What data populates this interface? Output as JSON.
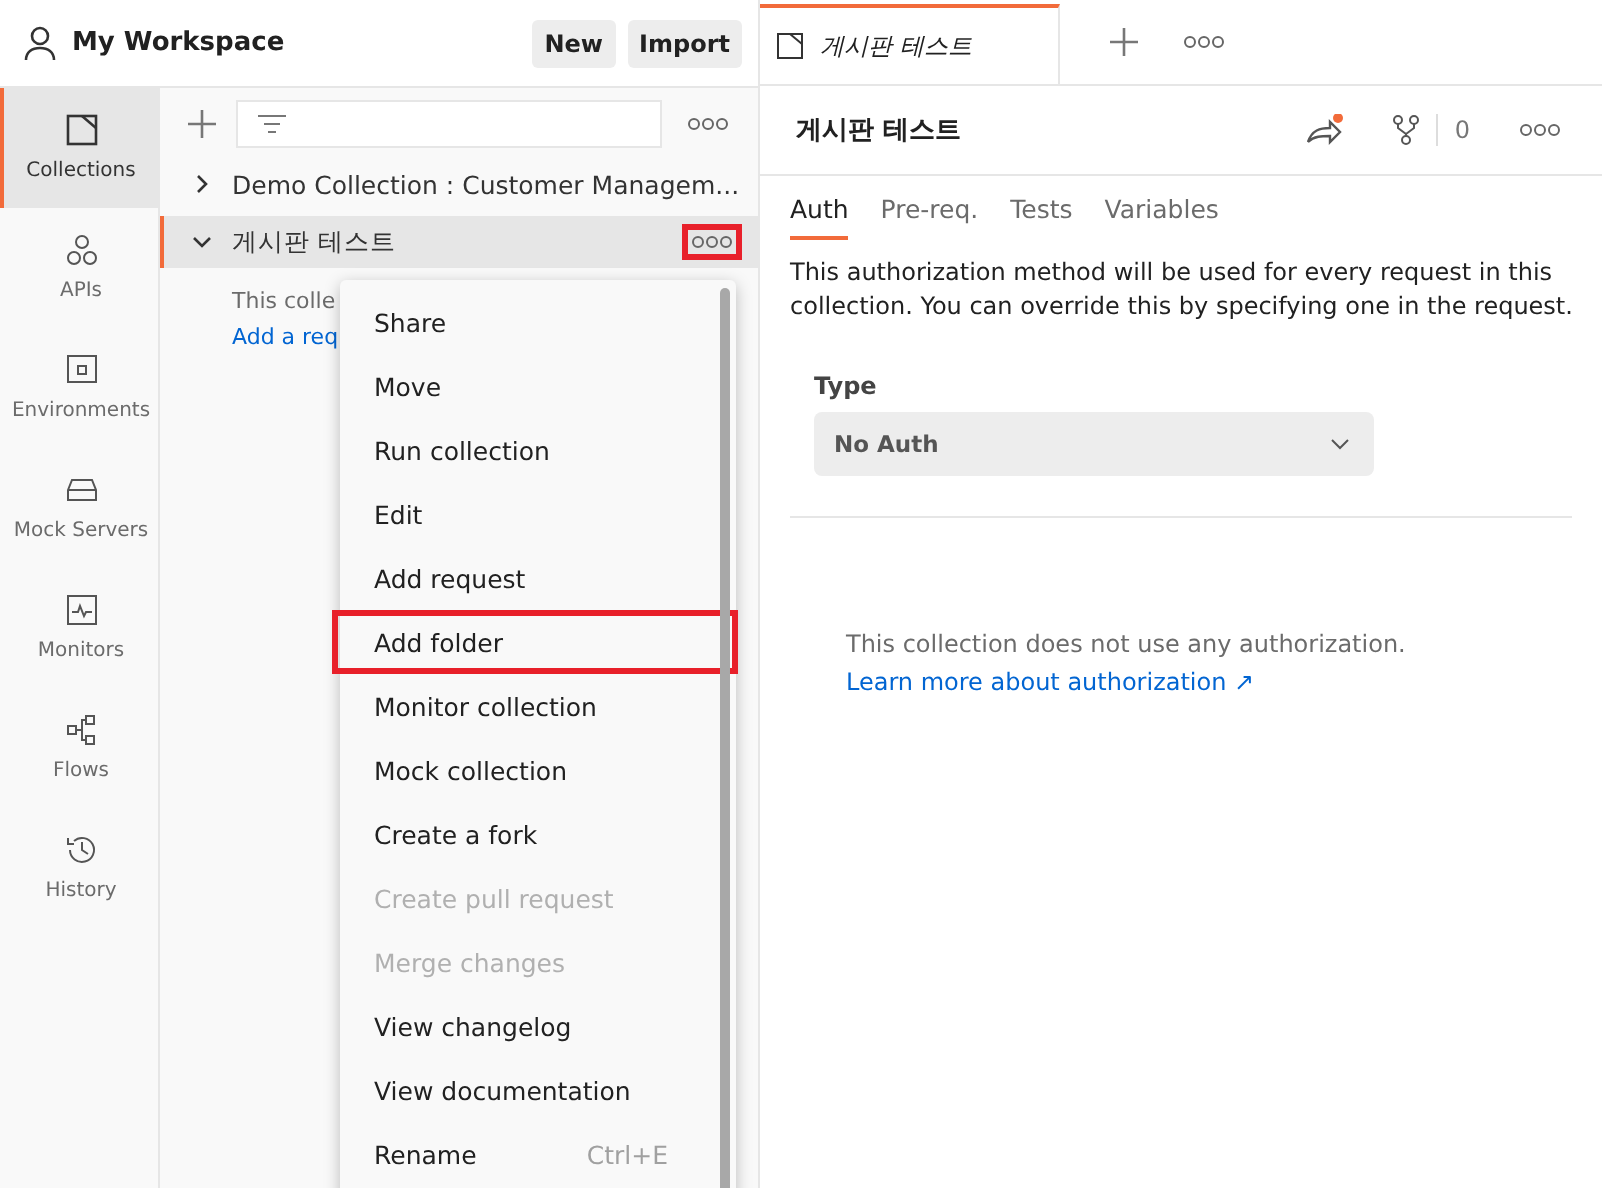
{
  "workspace": {
    "name": "My Workspace",
    "buttons": [
      "New",
      "Import"
    ]
  },
  "nav": [
    {
      "label": "Collections",
      "kind": "collections",
      "selected": true
    },
    {
      "label": "APIs",
      "kind": "apis",
      "selected": false
    },
    {
      "label": "Environments",
      "kind": "environments",
      "selected": false
    },
    {
      "label": "Mock Servers",
      "kind": "mock",
      "selected": false
    },
    {
      "label": "Monitors",
      "kind": "monitors",
      "selected": false
    },
    {
      "label": "Flows",
      "kind": "flows",
      "selected": false
    },
    {
      "label": "History",
      "kind": "history",
      "selected": false
    }
  ],
  "collections": [
    {
      "name": "Demo Collection : Customer Managem...",
      "expanded": false,
      "selected": false,
      "highlighted": false
    },
    {
      "name": "게시판 테스트",
      "expanded": true,
      "selected": true,
      "highlighted": true,
      "empty_text": "This colle",
      "link": "Add a req"
    }
  ],
  "menu": [
    {
      "label": "Share",
      "disabled": false,
      "highlighted": false
    },
    {
      "label": "Move",
      "disabled": false,
      "highlighted": false
    },
    {
      "label": "Run collection",
      "disabled": false,
      "highlighted": false
    },
    {
      "label": "Edit",
      "disabled": false,
      "highlighted": false
    },
    {
      "label": "Add request",
      "disabled": false,
      "highlighted": false
    },
    {
      "label": "Add folder",
      "disabled": false,
      "highlighted": true
    },
    {
      "label": "Monitor collection",
      "disabled": false,
      "highlighted": false
    },
    {
      "label": "Mock collection",
      "disabled": false,
      "highlighted": false
    },
    {
      "label": "Create a fork",
      "disabled": false,
      "highlighted": false
    },
    {
      "label": "Create pull request",
      "disabled": true,
      "highlighted": false
    },
    {
      "label": "Merge changes",
      "disabled": true,
      "highlighted": false
    },
    {
      "label": "View changelog",
      "disabled": false,
      "highlighted": false
    },
    {
      "label": "View documentation",
      "disabled": false,
      "highlighted": false
    },
    {
      "label": "Rename",
      "disabled": false,
      "highlighted": false,
      "shortcut": "Ctrl+E"
    }
  ],
  "tab": {
    "title": "게시판 테스트",
    "italic": true
  },
  "panel": {
    "title": "게시판 테스트",
    "fork_count": "0",
    "tabs": [
      {
        "label": "Auth",
        "selected": true
      },
      {
        "label": "Pre-req.",
        "selected": false
      },
      {
        "label": "Tests",
        "selected": false
      },
      {
        "label": "Variables",
        "selected": false
      }
    ],
    "description": "This authorization method will be used for every request in this collection. You can override this by specifying one in the request.",
    "type_label": "Type",
    "type_value": "No Auth",
    "note": "This collection does not use any authorization.",
    "learn_link": "Learn more about authorization ↗"
  }
}
